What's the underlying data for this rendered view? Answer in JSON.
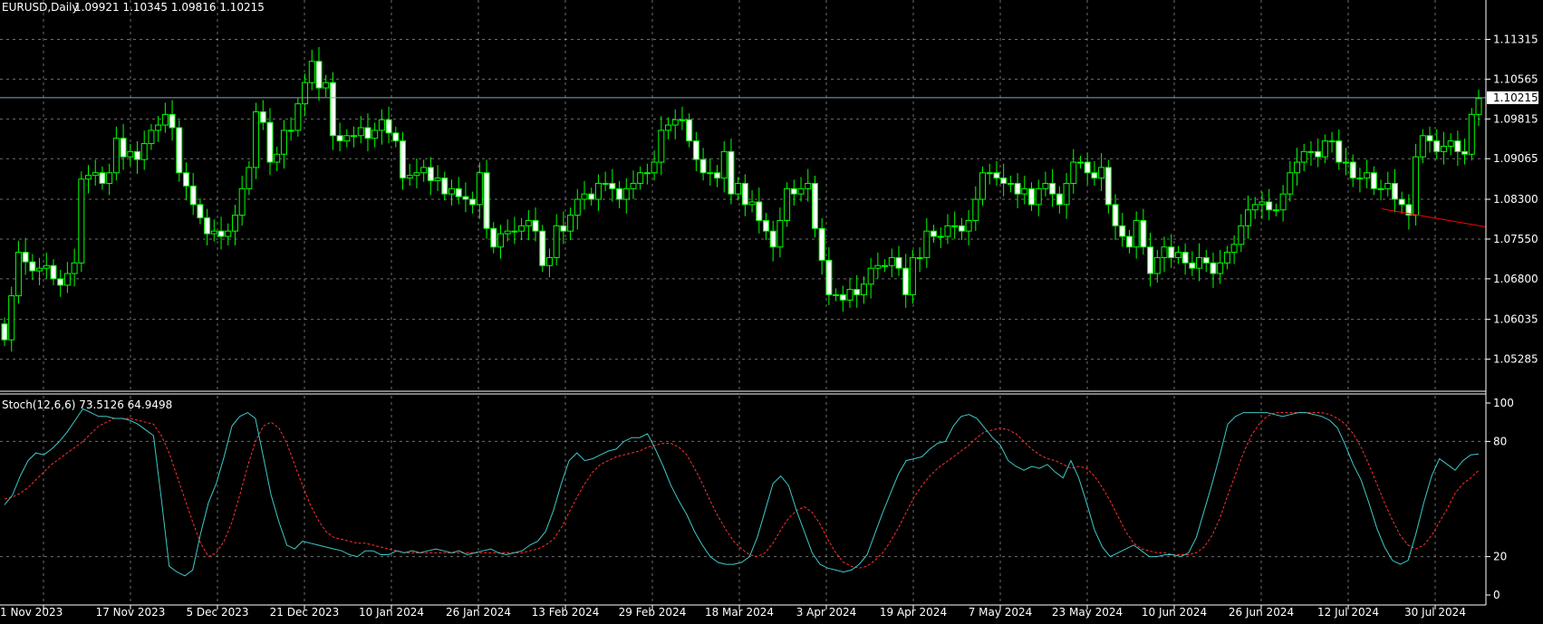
{
  "chart_data": [
    {
      "type": "candlestick",
      "title": "EURUSD,Daily",
      "ohlc_label": "1.09921 1.10345 1.09816 1.10215",
      "symbol": "EURUSD",
      "timeframe": "Daily",
      "ylim": [
        1.048,
        1.1175
      ],
      "y_ticks": [
        "1.11315",
        "1.10565",
        "1.09815",
        "1.09065",
        "1.08300",
        "1.07550",
        "1.06800",
        "1.06035",
        "1.05285"
      ],
      "current_price": "1.10215",
      "current_price_value": 1.10215,
      "x_ticks": [
        "1 Nov 2023",
        "17 Nov 2023",
        "5 Dec 2023",
        "21 Dec 2023",
        "10 Jan 2024",
        "26 Jan 2024",
        "13 Feb 2024",
        "29 Feb 2024",
        "18 Mar 2024",
        "3 Apr 2024",
        "19 Apr 2024",
        "7 May 2024",
        "23 May 2024",
        "10 Jun 2024",
        "26 Jun 2024",
        "12 Jul 2024",
        "30 Jul 2024"
      ],
      "grid": true,
      "colors": {
        "background": "#000000",
        "up_candle": "#00ff00",
        "down_candle": "#ffffff",
        "wick": "#00ff00",
        "grid": "#c8c8c8",
        "price_line": "#8ea0c0",
        "trendline": "#ff0000"
      },
      "trendline": {
        "start": {
          "x": "26 Jul 2024",
          "y": 1.0812
        },
        "end": {
          "x": "8 Aug 2024",
          "y": 1.0778
        }
      },
      "closes": [
        1.0565,
        1.0648,
        1.073,
        1.0712,
        1.0695,
        1.07,
        1.0705,
        1.068,
        1.0668,
        1.069,
        1.071,
        1.0868,
        1.0875,
        1.088,
        1.086,
        1.088,
        1.0945,
        1.091,
        1.092,
        1.0905,
        1.0935,
        1.096,
        1.097,
        1.099,
        1.0965,
        1.088,
        1.0855,
        1.082,
        1.0795,
        1.0765,
        1.077,
        1.076,
        1.077,
        1.08,
        1.085,
        1.089,
        1.0995,
        1.0975,
        1.09,
        1.0915,
        1.096,
        1.096,
        1.101,
        1.105,
        1.109,
        1.104,
        1.105,
        1.095,
        1.094,
        1.095,
        1.095,
        1.0965,
        1.0945,
        1.096,
        1.098,
        1.0955,
        1.094,
        1.087,
        1.0875,
        1.088,
        1.089,
        1.0865,
        1.087,
        1.084,
        1.085,
        1.0835,
        1.083,
        1.082,
        1.088,
        1.0775,
        1.074,
        1.0765,
        1.077,
        1.077,
        1.078,
        1.079,
        1.077,
        1.0705,
        1.072,
        1.078,
        1.077,
        1.08,
        1.083,
        1.084,
        1.083,
        1.086,
        1.086,
        1.085,
        1.083,
        1.085,
        1.086,
        1.088,
        1.088,
        1.09,
        1.096,
        1.097,
        1.098,
        1.098,
        1.094,
        1.0905,
        1.088,
        1.088,
        1.087,
        1.092,
        1.084,
        1.086,
        1.082,
        1.0825,
        1.079,
        1.077,
        1.074,
        1.079,
        1.085,
        1.084,
        1.085,
        1.086,
        1.0775,
        1.0715,
        1.065,
        1.065,
        1.064,
        1.066,
        1.065,
        1.067,
        1.07,
        1.0705,
        1.0705,
        1.072,
        1.07,
        1.065,
        1.072,
        1.072,
        1.077,
        1.076,
        1.076,
        1.078,
        1.078,
        1.077,
        1.079,
        1.083,
        1.088,
        1.088,
        1.087,
        1.086,
        1.086,
        1.084,
        1.085,
        1.082,
        1.085,
        1.086,
        1.084,
        1.082,
        1.086,
        1.09,
        1.09,
        1.088,
        1.087,
        1.089,
        1.082,
        1.078,
        1.076,
        1.074,
        1.079,
        1.074,
        1.069,
        1.072,
        1.074,
        1.072,
        1.073,
        1.071,
        1.07,
        1.072,
        1.071,
        1.069,
        1.071,
        1.073,
        1.0745,
        1.078,
        1.081,
        1.082,
        1.0825,
        1.081,
        1.081,
        1.084,
        1.088,
        1.09,
        1.092,
        1.092,
        1.091,
        1.094,
        1.094,
        1.09,
        1.09,
        1.087,
        1.087,
        1.088,
        1.085,
        1.085,
        1.086,
        1.083,
        1.082,
        1.08,
        1.091,
        1.095,
        1.094,
        1.092,
        1.093,
        1.094,
        1.092,
        1.0915,
        1.099,
        1.102
      ]
    },
    {
      "type": "line",
      "title": "Stoch(12,6,6) 73.5126 64.9498",
      "indicator": "Stoch(12,6,6)",
      "main_value": 73.5126,
      "signal_value": 64.9498,
      "ylim": [
        0,
        100
      ],
      "y_ticks": [
        "100",
        "80",
        "20",
        "0"
      ],
      "grid": true,
      "series": [
        {
          "style": "solid",
          "color": "#3fc8c8",
          "values": [
            47,
            52,
            62,
            70,
            74,
            73,
            76,
            80,
            85,
            91,
            97,
            95,
            93,
            93,
            92,
            92,
            91,
            89,
            86,
            83,
            50,
            15,
            12,
            10,
            13,
            32,
            48,
            58,
            72,
            88,
            93,
            95,
            92,
            72,
            52,
            38,
            26,
            24,
            28,
            27,
            26,
            25,
            24,
            23,
            21,
            20,
            23,
            23,
            21,
            21,
            23,
            22,
            23,
            22,
            23,
            24,
            23,
            22,
            23,
            21,
            22,
            23,
            24,
            22,
            21,
            22,
            23,
            26,
            28,
            33,
            44,
            58,
            70,
            74,
            70,
            71,
            73,
            75,
            76,
            80,
            82,
            82,
            84,
            76,
            67,
            57,
            49,
            42,
            33,
            26,
            20,
            17,
            16,
            16,
            17,
            20,
            30,
            44,
            58,
            62,
            57,
            44,
            33,
            22,
            16,
            14,
            13,
            12,
            13,
            16,
            21,
            32,
            43,
            53,
            63,
            70,
            71,
            72,
            76,
            79,
            80,
            88,
            93,
            94,
            92,
            87,
            82,
            78,
            70,
            67,
            65,
            67,
            66,
            68,
            64,
            61,
            70,
            61,
            48,
            34,
            25,
            20,
            22,
            24,
            26,
            23,
            20,
            20,
            21,
            21,
            20,
            22,
            30,
            44,
            58,
            73,
            89,
            93,
            95,
            95,
            95,
            95,
            94,
            93,
            94,
            95,
            95,
            94,
            93,
            91,
            87,
            78,
            68,
            60,
            48,
            35,
            25,
            18,
            16,
            18,
            32,
            48,
            62,
            71,
            68,
            65,
            70,
            73,
            73.51
          ]
        },
        {
          "style": "dashed",
          "color": "#ff3030",
          "values": [
            50,
            51,
            53,
            56,
            60,
            64,
            68,
            71,
            74,
            77,
            80,
            84,
            88,
            90,
            92,
            92,
            92,
            91,
            90,
            89,
            83,
            74,
            62,
            50,
            38,
            27,
            20,
            22,
            28,
            38,
            52,
            67,
            80,
            88,
            90,
            87,
            79,
            68,
            57,
            47,
            39,
            33,
            30,
            29,
            28,
            27,
            27,
            26,
            25,
            24,
            23,
            22,
            22,
            22,
            22,
            22,
            22,
            22,
            22,
            22,
            22,
            22,
            22,
            22,
            22,
            22,
            22,
            23,
            24,
            26,
            29,
            35,
            43,
            51,
            58,
            64,
            68,
            70,
            72,
            73,
            74,
            75,
            77,
            78,
            79,
            79,
            77,
            73,
            66,
            58,
            49,
            41,
            34,
            28,
            24,
            21,
            20,
            22,
            27,
            34,
            40,
            44,
            46,
            43,
            37,
            29,
            22,
            17,
            15,
            14,
            15,
            18,
            22,
            28,
            35,
            43,
            51,
            57,
            62,
            66,
            69,
            72,
            75,
            78,
            82,
            85,
            86,
            87,
            86,
            84,
            80,
            76,
            73,
            71,
            70,
            68,
            66,
            67,
            66,
            62,
            56,
            49,
            41,
            33,
            27,
            24,
            23,
            22,
            22,
            21,
            21,
            21,
            22,
            25,
            31,
            40,
            52,
            63,
            74,
            83,
            89,
            93,
            95,
            95,
            95,
            95,
            95,
            95,
            95,
            94,
            92,
            89,
            84,
            77,
            68,
            58,
            48,
            39,
            31,
            26,
            24,
            26,
            31,
            38,
            45,
            53,
            58,
            61,
            64.95
          ]
        }
      ],
      "x_ticks": [
        "1 Nov 2023",
        "17 Nov 2023",
        "5 Dec 2023",
        "21 Dec 2023",
        "10 Jan 2024",
        "26 Jan 2024",
        "13 Feb 2024",
        "29 Feb 2024",
        "18 Mar 2024",
        "3 Apr 2024",
        "19 Apr 2024",
        "7 May 2024",
        "23 May 2024",
        "10 Jun 2024",
        "26 Jun 2024",
        "12 Jul 2024",
        "30 Jul 2024"
      ]
    }
  ]
}
